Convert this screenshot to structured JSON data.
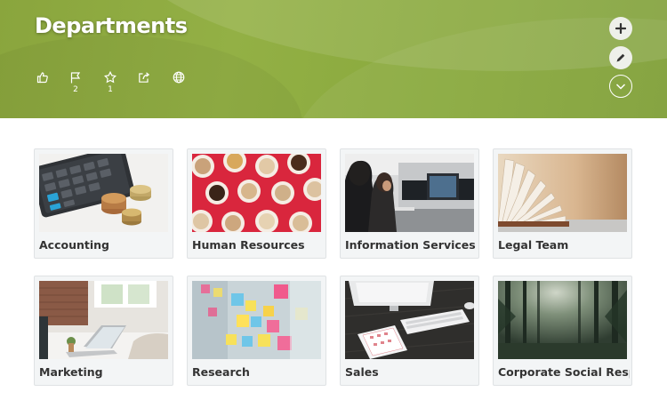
{
  "header": {
    "title": "Departments",
    "actions": [
      {
        "icon": "thumbs-up-icon",
        "count": ""
      },
      {
        "icon": "flag-icon",
        "count": "2"
      },
      {
        "icon": "star-icon",
        "count": "1"
      },
      {
        "icon": "share-icon",
        "count": ""
      },
      {
        "icon": "globe-icon",
        "count": ""
      }
    ],
    "right_buttons": [
      "plus-icon",
      "pencil-icon",
      "chevron-down-icon"
    ],
    "accent_color": "#8aa53d"
  },
  "tiles": [
    {
      "label": "Accounting"
    },
    {
      "label": "Human Resources"
    },
    {
      "label": "Information Services"
    },
    {
      "label": "Legal Team"
    },
    {
      "label": "Marketing"
    },
    {
      "label": "Research"
    },
    {
      "label": "Sales"
    },
    {
      "label": "Corporate Social Resp..."
    }
  ]
}
